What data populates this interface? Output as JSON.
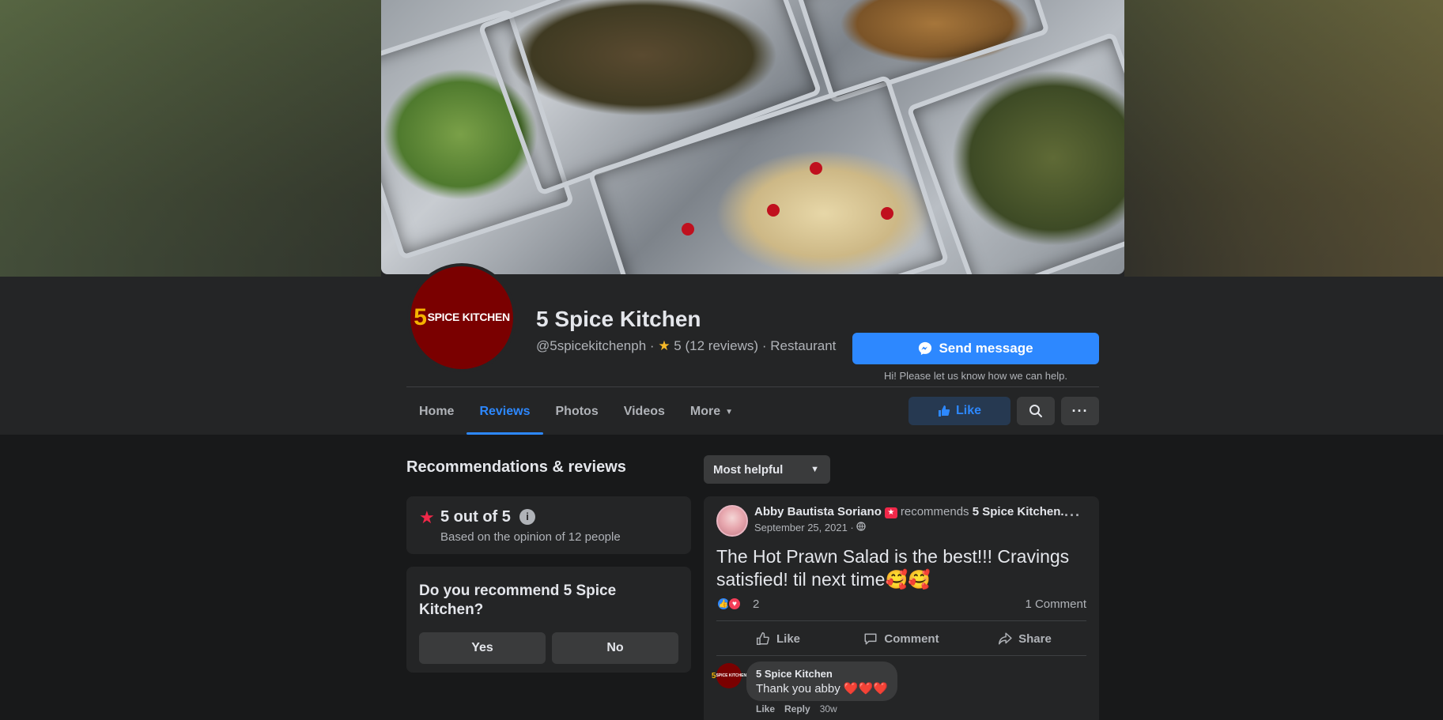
{
  "page": {
    "name": "5 Spice Kitchen",
    "logo_number": "5",
    "logo_text": "SPICE KITCHEN",
    "handle": "@5spicekitchenph",
    "separator": "·",
    "rating": "5",
    "reviews": "(12 reviews)",
    "category": "Restaurant"
  },
  "actions": {
    "send_message": "Send message",
    "send_hint": "Hi! Please let us know how we can help.",
    "like": "Like"
  },
  "tabs": [
    {
      "label": "Home"
    },
    {
      "label": "Reviews",
      "active": true
    },
    {
      "label": "Photos"
    },
    {
      "label": "Videos"
    },
    {
      "label": "More"
    }
  ],
  "reviews_section": {
    "title": "Recommendations & reviews",
    "sort": "Most helpful",
    "rating_main": "5 out of 5",
    "rating_sub": "Based on the opinion of 12 people",
    "question": "Do you recommend 5 Spice Kitchen?",
    "yes": "Yes",
    "no": "No"
  },
  "post": {
    "author": "Abby Bautista Soriano",
    "verb": "recommends",
    "target": "5 Spice Kitchen.",
    "date": "September 25, 2021 ·",
    "body": "The Hot Prawn Salad is the best!!! Cravings satisfied! til next time🥰🥰",
    "reaction_count": "2",
    "comment_count": "1 Comment",
    "like": "Like",
    "comment": "Comment",
    "share": "Share"
  },
  "comment": {
    "author": "5 Spice Kitchen",
    "text": "Thank you abby",
    "hearts": "❤️❤️❤️",
    "like": "Like",
    "reply": "Reply",
    "time": "30w"
  },
  "colors": {
    "accent": "#2d88ff",
    "background": "#18191a",
    "card": "#242526",
    "star": "#f7b928",
    "logo_bg": "#7a0000"
  }
}
